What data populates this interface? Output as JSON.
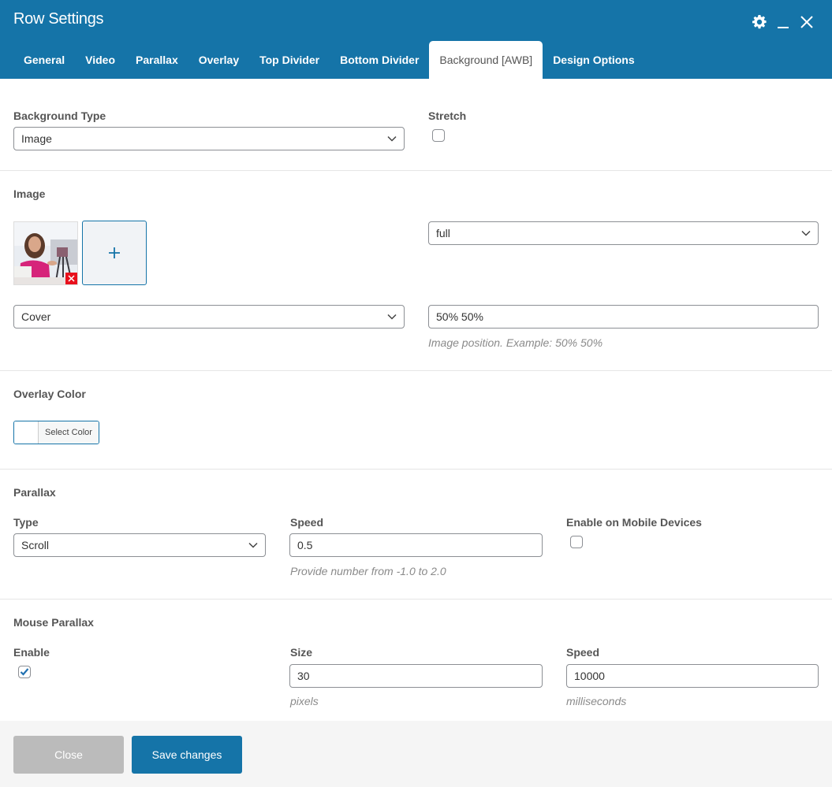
{
  "header": {
    "title": "Row Settings",
    "icons": [
      "gear-icon",
      "minimize-icon",
      "close-icon"
    ],
    "tabs": [
      {
        "label": "General",
        "active": false
      },
      {
        "label": "Video",
        "active": false
      },
      {
        "label": "Parallax",
        "active": false
      },
      {
        "label": "Overlay",
        "active": false
      },
      {
        "label": "Top Divider",
        "active": false
      },
      {
        "label": "Bottom Divider",
        "active": false
      },
      {
        "label": "Background [AWB]",
        "active": true
      },
      {
        "label": "Design Options",
        "active": false
      }
    ]
  },
  "background": {
    "type_label": "Background Type",
    "type_value": "Image",
    "stretch_label": "Stretch",
    "stretch_checked": false
  },
  "image": {
    "label": "Image",
    "size_value": "full",
    "fit_value": "Cover",
    "position_value": "50% 50%",
    "position_hint": "Image position. Example: 50% 50%",
    "add_icon": "plus-icon",
    "remove_icon": "remove-x-icon"
  },
  "overlay": {
    "label": "Overlay Color",
    "button_label": "Select Color",
    "color": "#ffffff"
  },
  "parallax": {
    "label": "Parallax",
    "type_label": "Type",
    "type_value": "Scroll",
    "speed_label": "Speed",
    "speed_value": "0.5",
    "speed_hint": "Provide number from -1.0 to 2.0",
    "mobile_label": "Enable on Mobile Devices",
    "mobile_checked": false
  },
  "mouse_parallax": {
    "label": "Mouse Parallax",
    "enable_label": "Enable",
    "enable_checked": true,
    "size_label": "Size",
    "size_value": "30",
    "size_hint": "pixels",
    "speed_label": "Speed",
    "speed_value": "10000",
    "speed_hint": "milliseconds"
  },
  "footer": {
    "close_label": "Close",
    "save_label": "Save changes"
  },
  "colors": {
    "brand": "#1574a8",
    "close_button": "#bbbbbb",
    "remove_badge": "#e8101c"
  }
}
